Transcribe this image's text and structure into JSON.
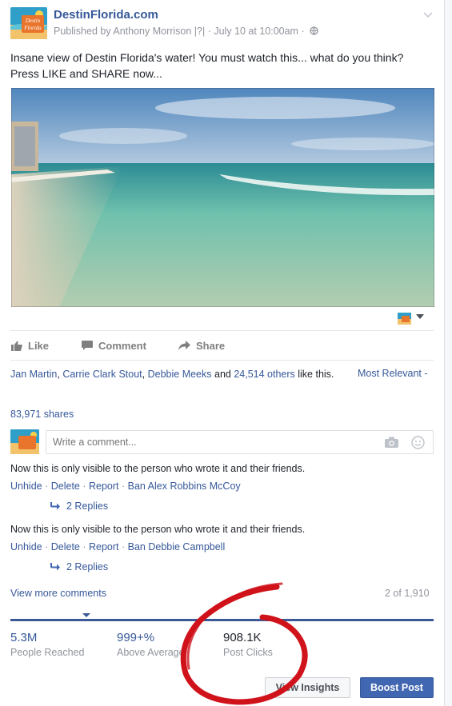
{
  "colors": {
    "link": "#365899",
    "boost": "#4267b2",
    "annotation": "#d0121a"
  },
  "post": {
    "page_name": "DestinFlorida.com",
    "logo_text_top": "Destin",
    "logo_text_bottom": "Florida",
    "published": "Published by Anthony Morrison |?| · July 10 at 10:00am ·",
    "text": "Insane view of Destin Florida's water! You must watch this... what do you think? Press LIKE and SHARE now...",
    "video_icon": "beach-video-thumbnail"
  },
  "actions": {
    "like": "Like",
    "comment": "Comment",
    "share": "Share"
  },
  "likes": {
    "name1": "Jan Martin",
    "sep1": ", ",
    "name2": "Carrie Clark Stout",
    "sep2": ", ",
    "name3": "Debbie Meeks",
    "and": " and ",
    "others": "24,514 others",
    "suffix": " like this.",
    "sort": "Most Relevant -"
  },
  "shares": "83,971 shares",
  "comment_box": {
    "placeholder": "Write a comment..."
  },
  "hidden_comments": [
    {
      "note": "Now this is only visible to the person who wrote it and their friends.",
      "unhide": "Unhide",
      "delete": "Delete",
      "report": "Report",
      "ban": "Ban Alex Robbins McCoy",
      "replies": "2 Replies"
    },
    {
      "note": "Now this is only visible to the person who wrote it and their friends.",
      "unhide": "Unhide",
      "delete": "Delete",
      "report": "Report",
      "ban": "Ban Debbie Campbell",
      "replies": "2 Replies"
    }
  ],
  "separator": " · ",
  "view_more": "View more comments",
  "comment_count": "2 of 1,910",
  "insights": {
    "reached_value": "5.3M",
    "reached_label": "People Reached",
    "above_value": "999+%",
    "above_label": "Above Average",
    "clicks_value": "908.1K",
    "clicks_label": "Post Clicks"
  },
  "buttons": {
    "view_insights": "View Insights",
    "boost": "Boost Post"
  }
}
